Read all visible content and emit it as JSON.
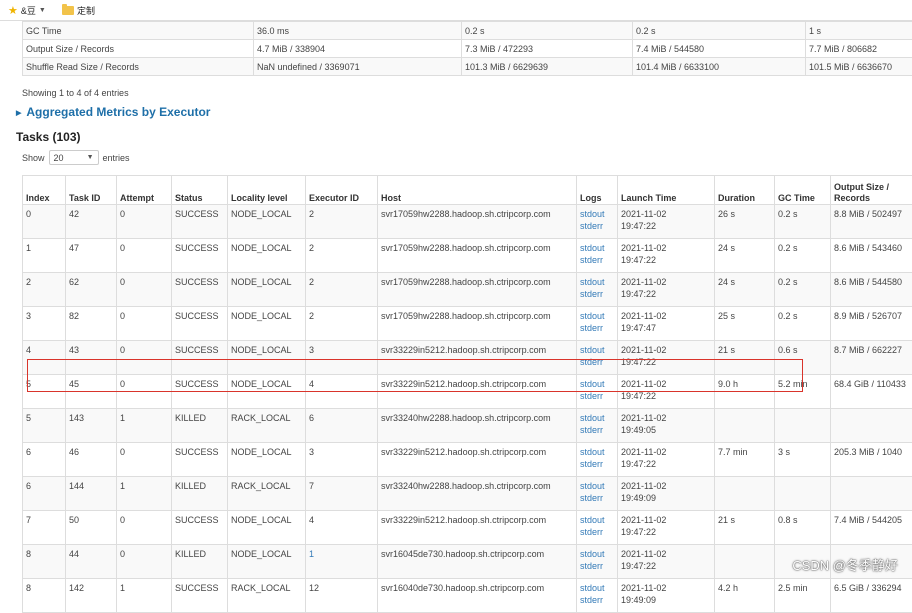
{
  "bookmarks": [
    {
      "icon": "star-icon",
      "label": "&豆"
    },
    {
      "icon": "folder-icon",
      "label": "定制"
    }
  ],
  "summary_rows": [
    [
      "GC Time",
      "36.0 ms",
      "0.2 s",
      "0.2 s",
      "1 s"
    ],
    [
      "Output Size / Records",
      "4.7 MiB / 338904",
      "7.3 MiB / 472293",
      "7.4 MiB / 544580",
      "7.7 MiB / 806682"
    ],
    [
      "Shuffle Read Size / Records",
      "NaN undefined / 3369071",
      "101.3 MiB / 6629639",
      "101.4 MiB / 6633100",
      "101.5 MiB / 6636670"
    ]
  ],
  "showing_text": "Showing 1 to 4 of 4 entries",
  "aggregated_link": "Aggregated Metrics by Executor",
  "tasks_heading": "Tasks (103)",
  "show_label": "Show",
  "show_value": "20",
  "entries_label": "entries",
  "columns": [
    "Index",
    "Task ID",
    "Attempt",
    "Status",
    "Locality level",
    "Executor ID",
    "Host",
    "Logs",
    "Launch Time",
    "Duration",
    "GC Time",
    "Output Size / Records"
  ],
  "rows": [
    {
      "index": "0",
      "task_id": "42",
      "attempt": "0",
      "status": "SUCCESS",
      "locality": "NODE_LOCAL",
      "executor": "2",
      "host": "svr17059hw2288.hadoop.sh.ctripcorp.com",
      "log1": "stdout",
      "log2": "stderr",
      "launch1": "2021-11-02",
      "launch2": "19:47:22",
      "duration": "26 s",
      "gc": "0.2 s",
      "output": "8.8 MiB / 502497"
    },
    {
      "index": "1",
      "task_id": "47",
      "attempt": "0",
      "status": "SUCCESS",
      "locality": "NODE_LOCAL",
      "executor": "2",
      "host": "svr17059hw2288.hadoop.sh.ctripcorp.com",
      "log1": "stdout",
      "log2": "stderr",
      "launch1": "2021-11-02",
      "launch2": "19:47:22",
      "duration": "24 s",
      "gc": "0.2 s",
      "output": "8.6 MiB / 543460"
    },
    {
      "index": "2",
      "task_id": "62",
      "attempt": "0",
      "status": "SUCCESS",
      "locality": "NODE_LOCAL",
      "executor": "2",
      "host": "svr17059hw2288.hadoop.sh.ctripcorp.com",
      "log1": "stdout",
      "log2": "stderr",
      "launch1": "2021-11-02",
      "launch2": "19:47:22",
      "duration": "24 s",
      "gc": "0.2 s",
      "output": "8.6 MiB / 544580"
    },
    {
      "index": "3",
      "task_id": "82",
      "attempt": "0",
      "status": "SUCCESS",
      "locality": "NODE_LOCAL",
      "executor": "2",
      "host": "svr17059hw2288.hadoop.sh.ctripcorp.com",
      "log1": "stdout",
      "log2": "stderr",
      "launch1": "2021-11-02",
      "launch2": "19:47:47",
      "duration": "25 s",
      "gc": "0.2 s",
      "output": "8.9 MiB / 526707"
    },
    {
      "index": "4",
      "task_id": "43",
      "attempt": "0",
      "status": "SUCCESS",
      "locality": "NODE_LOCAL",
      "executor": "3",
      "host": "svr33229in5212.hadoop.sh.ctripcorp.com",
      "log1": "stdout",
      "log2": "stderr",
      "launch1": "2021-11-02",
      "launch2": "19:47:22",
      "duration": "21 s",
      "gc": "0.6 s",
      "output": "8.7 MiB / 662227"
    },
    {
      "index": "5",
      "task_id": "45",
      "attempt": "0",
      "status": "SUCCESS",
      "locality": "NODE_LOCAL",
      "executor": "4",
      "host": "svr33229in5212.hadoop.sh.ctripcorp.com",
      "log1": "stdout",
      "log2": "stderr",
      "launch1": "2021-11-02",
      "launch2": "19:47:22",
      "duration": "9.0 h",
      "gc": "5.2 min",
      "output": "68.4 GiB / 110433"
    },
    {
      "index": "5",
      "task_id": "143",
      "attempt": "1",
      "status": "KILLED",
      "locality": "RACK_LOCAL",
      "executor": "6",
      "host": "svr33240hw2288.hadoop.sh.ctripcorp.com",
      "log1": "stdout",
      "log2": "stderr",
      "launch1": "2021-11-02",
      "launch2": "19:49:05",
      "duration": "",
      "gc": "",
      "output": ""
    },
    {
      "index": "6",
      "task_id": "46",
      "attempt": "0",
      "status": "SUCCESS",
      "locality": "NODE_LOCAL",
      "executor": "3",
      "host": "svr33229in5212.hadoop.sh.ctripcorp.com",
      "log1": "stdout",
      "log2": "stderr",
      "launch1": "2021-11-02",
      "launch2": "19:47:22",
      "duration": "7.7 min",
      "gc": "3 s",
      "output": "205.3 MiB / 1040"
    },
    {
      "index": "6",
      "task_id": "144",
      "attempt": "1",
      "status": "KILLED",
      "locality": "RACK_LOCAL",
      "executor": "7",
      "host": "svr33240hw2288.hadoop.sh.ctripcorp.com",
      "log1": "stdout",
      "log2": "stderr",
      "launch1": "2021-11-02",
      "launch2": "19:49:09",
      "duration": "",
      "gc": "",
      "output": ""
    },
    {
      "index": "7",
      "task_id": "50",
      "attempt": "0",
      "status": "SUCCESS",
      "locality": "NODE_LOCAL",
      "executor": "4",
      "host": "svr33229in5212.hadoop.sh.ctripcorp.com",
      "log1": "stdout",
      "log2": "stderr",
      "launch1": "2021-11-02",
      "launch2": "19:47:22",
      "duration": "21 s",
      "gc": "0.8 s",
      "output": "7.4 MiB / 544205"
    },
    {
      "index": "8",
      "task_id": "44",
      "attempt": "0",
      "status": "KILLED",
      "locality": "NODE_LOCAL",
      "executor": "1",
      "host": "svr16045de730.hadoop.sh.ctripcorp.com",
      "log1": "stdout",
      "log2": "stderr",
      "launch1": "2021-11-02",
      "launch2": "19:47:22",
      "duration": "",
      "gc": "",
      "output": ""
    },
    {
      "index": "8",
      "task_id": "142",
      "attempt": "1",
      "status": "SUCCESS",
      "locality": "RACK_LOCAL",
      "executor": "12",
      "host": "svr16040de730.hadoop.sh.ctripcorp.com",
      "log1": "stdout",
      "log2": "stderr",
      "launch1": "2021-11-02",
      "launch2": "19:49:09",
      "duration": "4.2 h",
      "gc": "2.5 min",
      "output": "6.5 GiB / 336294"
    }
  ],
  "watermark": "CSDN @冬季静好"
}
